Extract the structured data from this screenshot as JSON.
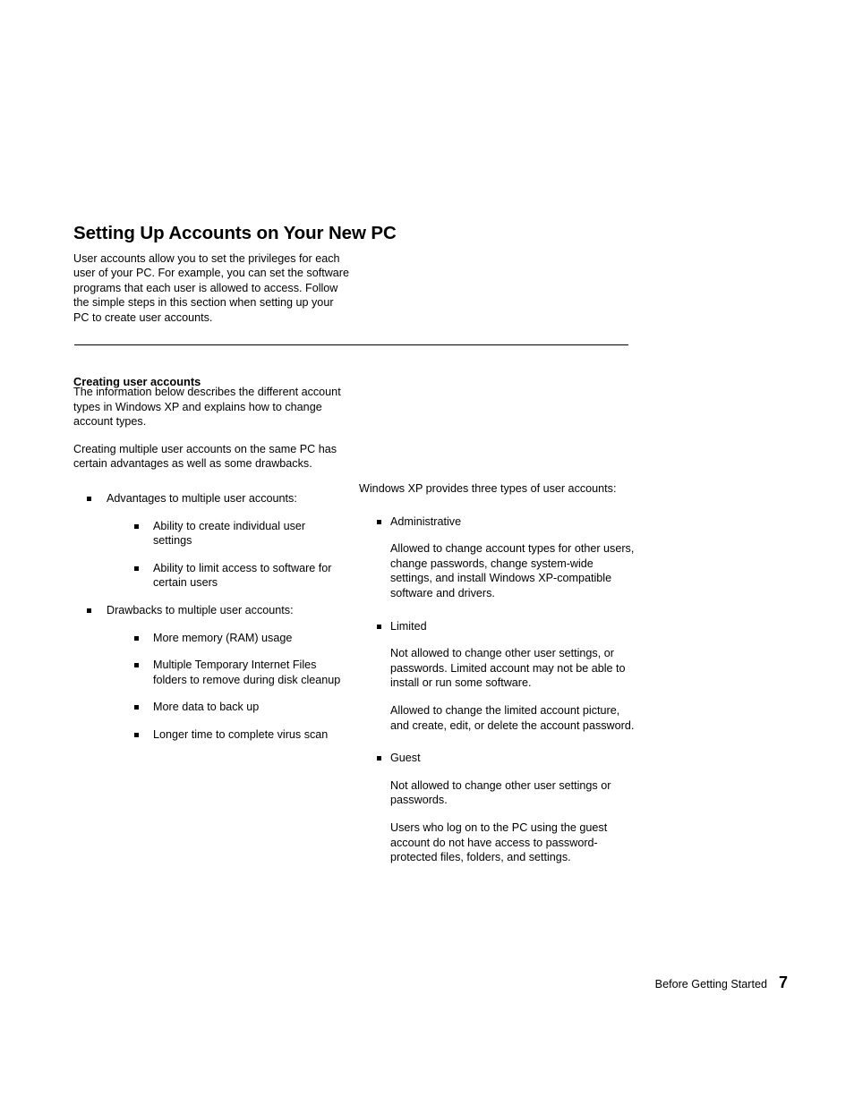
{
  "document": {
    "section_title": "Setting Up Accounts on Your New PC",
    "intro": "User accounts allow you to set the privileges for each user of your PC. For example, you can set the software programs that each user is allowed to access. Follow the simple steps in this section when setting up your PC to create user accounts.",
    "subsection": {
      "heading": "Creating user accounts",
      "paragraphs": [
        "The information below describes the different account types in Windows XP and explains how to change account types.",
        "Creating multiple user accounts on the same PC has certain advantages as well as some drawbacks."
      ]
    },
    "left_column": {
      "groups": [
        {
          "label": "Advantages to multiple user accounts:",
          "items": [
            "Ability to create individual user settings",
            "Ability to limit access to software for certain users"
          ]
        },
        {
          "label": "Drawbacks to multiple user accounts:",
          "items": [
            "More memory (RAM) usage",
            "Multiple Temporary Internet Files folders to remove during disk cleanup",
            "More data to back up",
            "Longer time to complete virus scan"
          ]
        }
      ]
    },
    "right_column": {
      "lead": "Windows XP provides three types of user accounts:",
      "account_types": [
        {
          "name": "Administrative",
          "details": [
            "Allowed to change account types for other users, change passwords, change system-wide settings, and install Windows XP-compatible software and drivers."
          ]
        },
        {
          "name": "Limited",
          "details": [
            "Not allowed to change other user settings, or passwords. Limited account may not be able to install or run some software.",
            "Allowed to change the limited account picture, and create, edit, or delete the account password."
          ]
        },
        {
          "name": "Guest",
          "details": [
            "Not allowed to change other user settings or passwords.",
            "Users who log on to the PC using the guest account do not have access to password-protected files, folders, and settings."
          ]
        }
      ]
    },
    "footer": {
      "label": "Before Getting Started",
      "page_number": "7"
    },
    "colors": {
      "text": "#000000",
      "background": "#ffffff",
      "rule": "#000000"
    }
  }
}
